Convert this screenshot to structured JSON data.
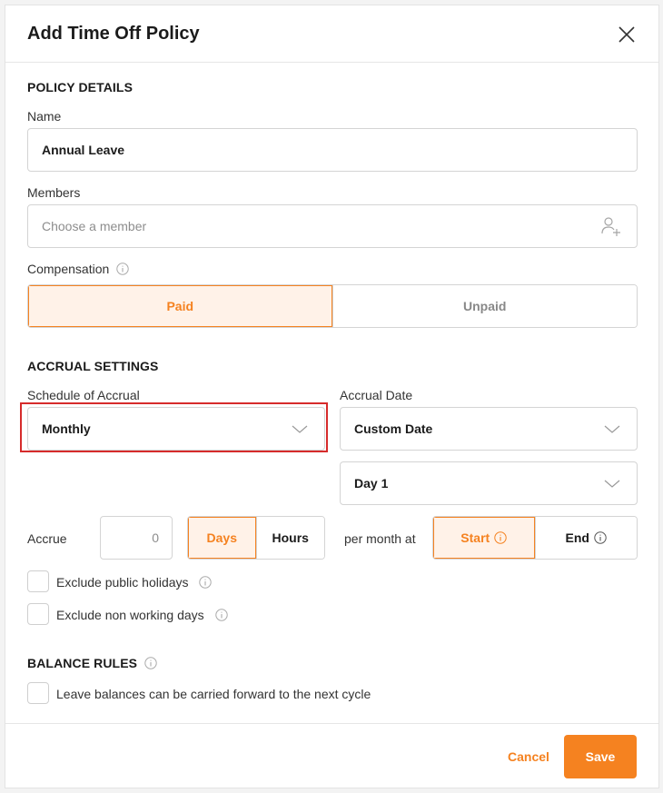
{
  "modal": {
    "title": "Add Time Off Policy"
  },
  "policy_details": {
    "section_title": "POLICY DETAILS",
    "name_label": "Name",
    "name_value": "Annual Leave",
    "members_label": "Members",
    "members_placeholder": "Choose a member",
    "compensation_label": "Compensation",
    "compensation_options": [
      "Paid",
      "Unpaid"
    ],
    "compensation_selected": "Paid"
  },
  "accrual_settings": {
    "section_title": "ACCRUAL SETTINGS",
    "schedule_label": "Schedule of Accrual",
    "schedule_value": "Monthly",
    "accrual_date_label": "Accrual Date",
    "accrual_date_value": "Custom Date",
    "day_value": "Day 1",
    "accrue_label": "Accrue",
    "accrue_placeholder": "0",
    "unit_options": [
      "Days",
      "Hours"
    ],
    "unit_selected": "Days",
    "per_month_label": "per month at",
    "timing_options": [
      "Start",
      "End"
    ],
    "timing_selected": "Start",
    "exclude_holidays_label": "Exclude public holidays",
    "exclude_nonworking_label": "Exclude non working days"
  },
  "balance_rules": {
    "section_title": "BALANCE RULES",
    "carry_forward_label": "Leave balances can be carried forward to the next cycle"
  },
  "footer": {
    "cancel_label": "Cancel",
    "save_label": "Save"
  },
  "colors": {
    "accent": "#f58220",
    "accent_bg": "#fff2e8",
    "highlight": "#d62b2b"
  }
}
